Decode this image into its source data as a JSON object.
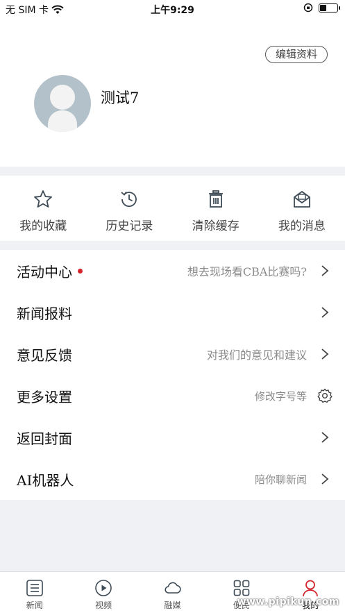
{
  "status_bar": {
    "carrier": "无 SIM 卡",
    "time": "上午9:29",
    "battery_level": 0.35
  },
  "profile": {
    "edit_label": "编辑资料",
    "username": "测试7"
  },
  "shortcuts": [
    {
      "label": "我的收藏",
      "icon": "star-icon"
    },
    {
      "label": "历史记录",
      "icon": "history-icon"
    },
    {
      "label": "清除缓存",
      "icon": "trash-icon"
    },
    {
      "label": "我的消息",
      "icon": "mail-icon"
    }
  ],
  "menu": [
    {
      "title": "活动中心",
      "subtitle": "想去现场看CBA比赛吗?",
      "badge": true,
      "trail": "chevron-right-icon"
    },
    {
      "title": "新闻报料",
      "subtitle": "",
      "badge": false,
      "trail": "chevron-right-icon"
    },
    {
      "title": "意见反馈",
      "subtitle": "对我们的意见和建议",
      "badge": false,
      "trail": "chevron-right-icon"
    },
    {
      "title": "更多设置",
      "subtitle": "修改字号等",
      "badge": false,
      "trail": "gear-icon"
    },
    {
      "title": "返回封面",
      "subtitle": "",
      "badge": false,
      "trail": "chevron-right-icon"
    },
    {
      "title": "AI机器人",
      "subtitle": "陪你聊新闻",
      "badge": false,
      "trail": "chevron-right-icon"
    }
  ],
  "tabbar": [
    {
      "label": "新闻",
      "icon": "news-icon",
      "active": false
    },
    {
      "label": "视频",
      "icon": "play-icon",
      "active": false
    },
    {
      "label": "融媒",
      "icon": "cloud-icon",
      "active": false
    },
    {
      "label": "便民",
      "icon": "grid-icon",
      "active": false
    },
    {
      "label": "我的",
      "icon": "user-icon",
      "active": true
    }
  ],
  "watermark": "www.pipikun.com",
  "colors": {
    "accent": "#d3252b",
    "icon": "#3d4a55",
    "background": "#f0f1f5"
  }
}
